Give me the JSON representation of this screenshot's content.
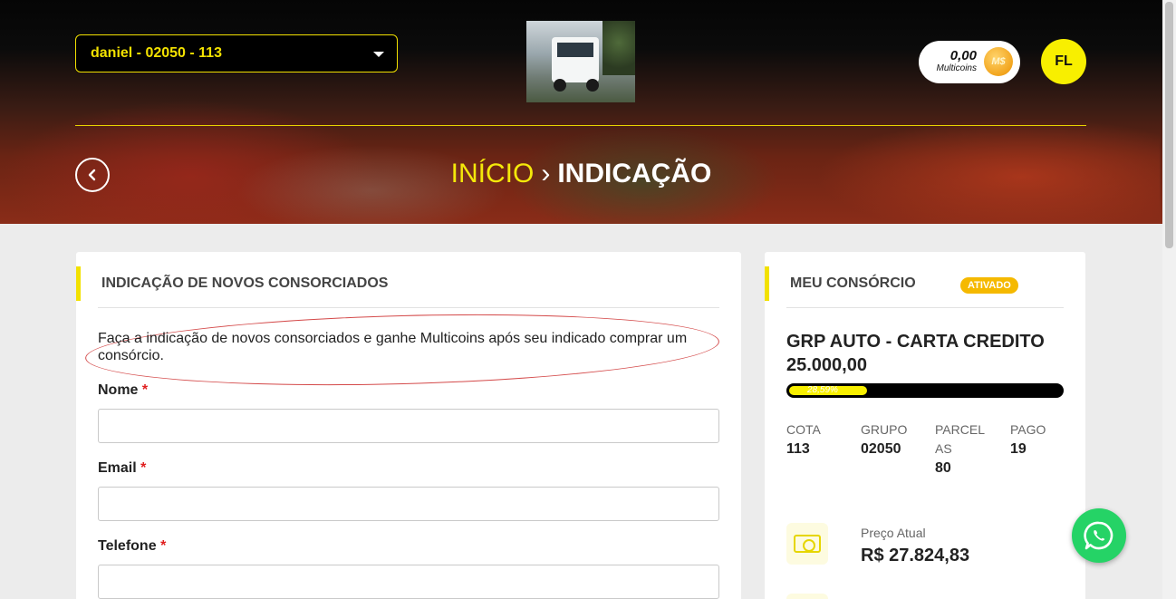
{
  "header": {
    "cota_selector_value": "daniel - 02050 - 113",
    "multicoins": {
      "value": "0,00",
      "label": "Multicoins",
      "coin_symbol": "M$"
    },
    "user_initials": "FL",
    "breadcrumb": {
      "home": "INÍCIO",
      "separator": "›",
      "current": "INDICAÇÃO"
    }
  },
  "referral_form": {
    "title": "INDICAÇÃO DE NOVOS CONSORCIADOS",
    "description": "Faça a indicação de novos consorciados e ganhe Multicoins após seu indicado comprar um consórcio.",
    "fields": [
      {
        "label": "Nome",
        "required_mark": "*",
        "value": ""
      },
      {
        "label": "Email",
        "required_mark": "*",
        "value": ""
      },
      {
        "label": "Telefone",
        "required_mark": "*",
        "value": ""
      }
    ]
  },
  "my_consortium": {
    "title": "MEU CONSÓRCIO",
    "status_badge": "ATIVADO",
    "plan_name": "GRP AUTO - CARTA CREDITO 25.000,00",
    "progress": {
      "percent": 28.59,
      "label": "28,59%"
    },
    "stats": [
      {
        "key": "COTA",
        "value": "113"
      },
      {
        "key": "GRUPO",
        "value": "02050"
      },
      {
        "key": "PARCELAS",
        "value": "80"
      },
      {
        "key": "PAGO",
        "value": "19"
      }
    ],
    "price": {
      "label": "Preço Atual",
      "value": "R$ 27.824,83"
    }
  },
  "colors": {
    "accent": "#f2e100",
    "badge": "#f5b900",
    "whatsapp": "#25d366",
    "required": "#e01e1e"
  },
  "icons": {
    "back": "chevron-left-icon",
    "select": "caret-down-icon",
    "coin": "coin-icon",
    "price": "money-bill-icon",
    "chat": "whatsapp-icon"
  }
}
